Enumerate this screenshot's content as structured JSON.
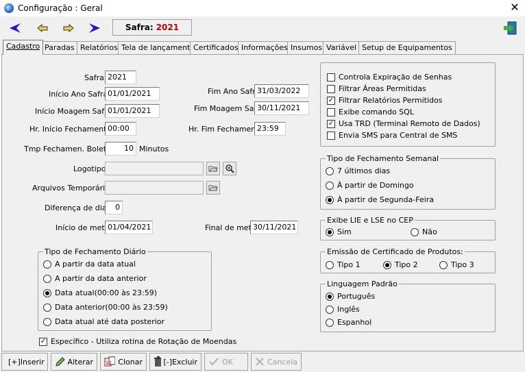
{
  "window": {
    "title": "Configuração : Geral"
  },
  "toolbar": {
    "safra_label": "Safra:",
    "safra_value": "2021"
  },
  "tabs": [
    {
      "label": "Cadastro"
    },
    {
      "label": "Paradas"
    },
    {
      "label": "Relatórios"
    },
    {
      "label": "Tela de lançamento"
    },
    {
      "label": "Certificados"
    },
    {
      "label": "Informações"
    },
    {
      "label": "Insumos"
    },
    {
      "label": "Variável"
    },
    {
      "label": "Setup de Equipamentos"
    }
  ],
  "form": {
    "safra": {
      "label": "Safra",
      "value": "2021"
    },
    "inicio_ano": {
      "label": "Início Ano Safra",
      "value": "01/01/2021"
    },
    "fim_ano": {
      "label": "Fim Ano Safra",
      "value": "31/03/2022"
    },
    "inicio_moagem": {
      "label": "Início Moagem Safra",
      "value": "01/01/2021"
    },
    "fim_moagem": {
      "label": "Fim Moagem Safra",
      "value": "30/11/2021"
    },
    "hr_inicio": {
      "label": "Hr. Início Fechamento",
      "value": "00:00"
    },
    "hr_fim": {
      "label": "Hr. Fim Fechamento",
      "value": "23:59"
    },
    "tmp_fech": {
      "label": "Tmp Fechamen. Boletim",
      "value": "10",
      "unit": "Minutos"
    },
    "logotipo": {
      "label": "Logotipo",
      "value": ""
    },
    "arquivos": {
      "label": "Arquivos Temporários",
      "value": ""
    },
    "diferenca": {
      "label": "Diferença de dias",
      "value": "0"
    },
    "inicio_meta": {
      "label": "Início de meta",
      "value": "01/04/2021"
    },
    "final_meta": {
      "label": "Final de meta",
      "value": "30/11/2021"
    }
  },
  "fech_diario": {
    "title": "Tipo de Fechamento Diário",
    "options": [
      {
        "label": "A partir da data atual",
        "checked": false
      },
      {
        "label": "A partir da data anterior",
        "checked": false
      },
      {
        "label": "Data atual(00:00 às 23:59)",
        "checked": true
      },
      {
        "label": "Data anterior(00:00 às 23:59)",
        "checked": false
      },
      {
        "label": "Data atual até data posterior",
        "checked": false
      }
    ]
  },
  "especifico": {
    "label": "Específico - Utiliza rotina de Rotação de Moendas",
    "checked": true
  },
  "checks": [
    {
      "label": "Controla Expiração de Senhas",
      "checked": false
    },
    {
      "label": "Filtrar Áreas Permitidas",
      "checked": false
    },
    {
      "label": "Filtrar Relatórios Permitidos",
      "checked": true
    },
    {
      "label": "Exibe comando SQL",
      "checked": false
    },
    {
      "label": "Usa TRD (Terminal Remoto de Dados)",
      "checked": true
    },
    {
      "label": "Envia SMS para Central de SMS",
      "checked": false
    }
  ],
  "fech_semanal": {
    "title": "Tipo de Fechamento Semanal",
    "options": [
      {
        "label": "7 últimos dias",
        "checked": false
      },
      {
        "label": "À partir de Domingo",
        "checked": false
      },
      {
        "label": "À partir de Segunda-Feira",
        "checked": true
      }
    ]
  },
  "lie_lse": {
    "title": "Exibe LIE e LSE no CEP",
    "options": [
      {
        "label": "Sim",
        "checked": true
      },
      {
        "label": "Não",
        "checked": false
      }
    ]
  },
  "certificado": {
    "title": "Emissão de Certificado de Produtos:",
    "options": [
      {
        "label": "Tipo 1",
        "checked": false
      },
      {
        "label": "Tipo 2",
        "checked": true
      },
      {
        "label": "Tipo 3",
        "checked": false
      }
    ]
  },
  "linguagem": {
    "title": "Linguagem Padrão",
    "options": [
      {
        "label": "Português",
        "checked": true
      },
      {
        "label": "Inglês",
        "checked": false
      },
      {
        "label": "Espanhol",
        "checked": false
      }
    ]
  },
  "bottom": {
    "inserir": "[+]Inserir",
    "alterar": "Alterar",
    "clonar": "Clonar",
    "excluir": "[-]Excluir",
    "ok": "OK",
    "cancela": "Cancela"
  }
}
